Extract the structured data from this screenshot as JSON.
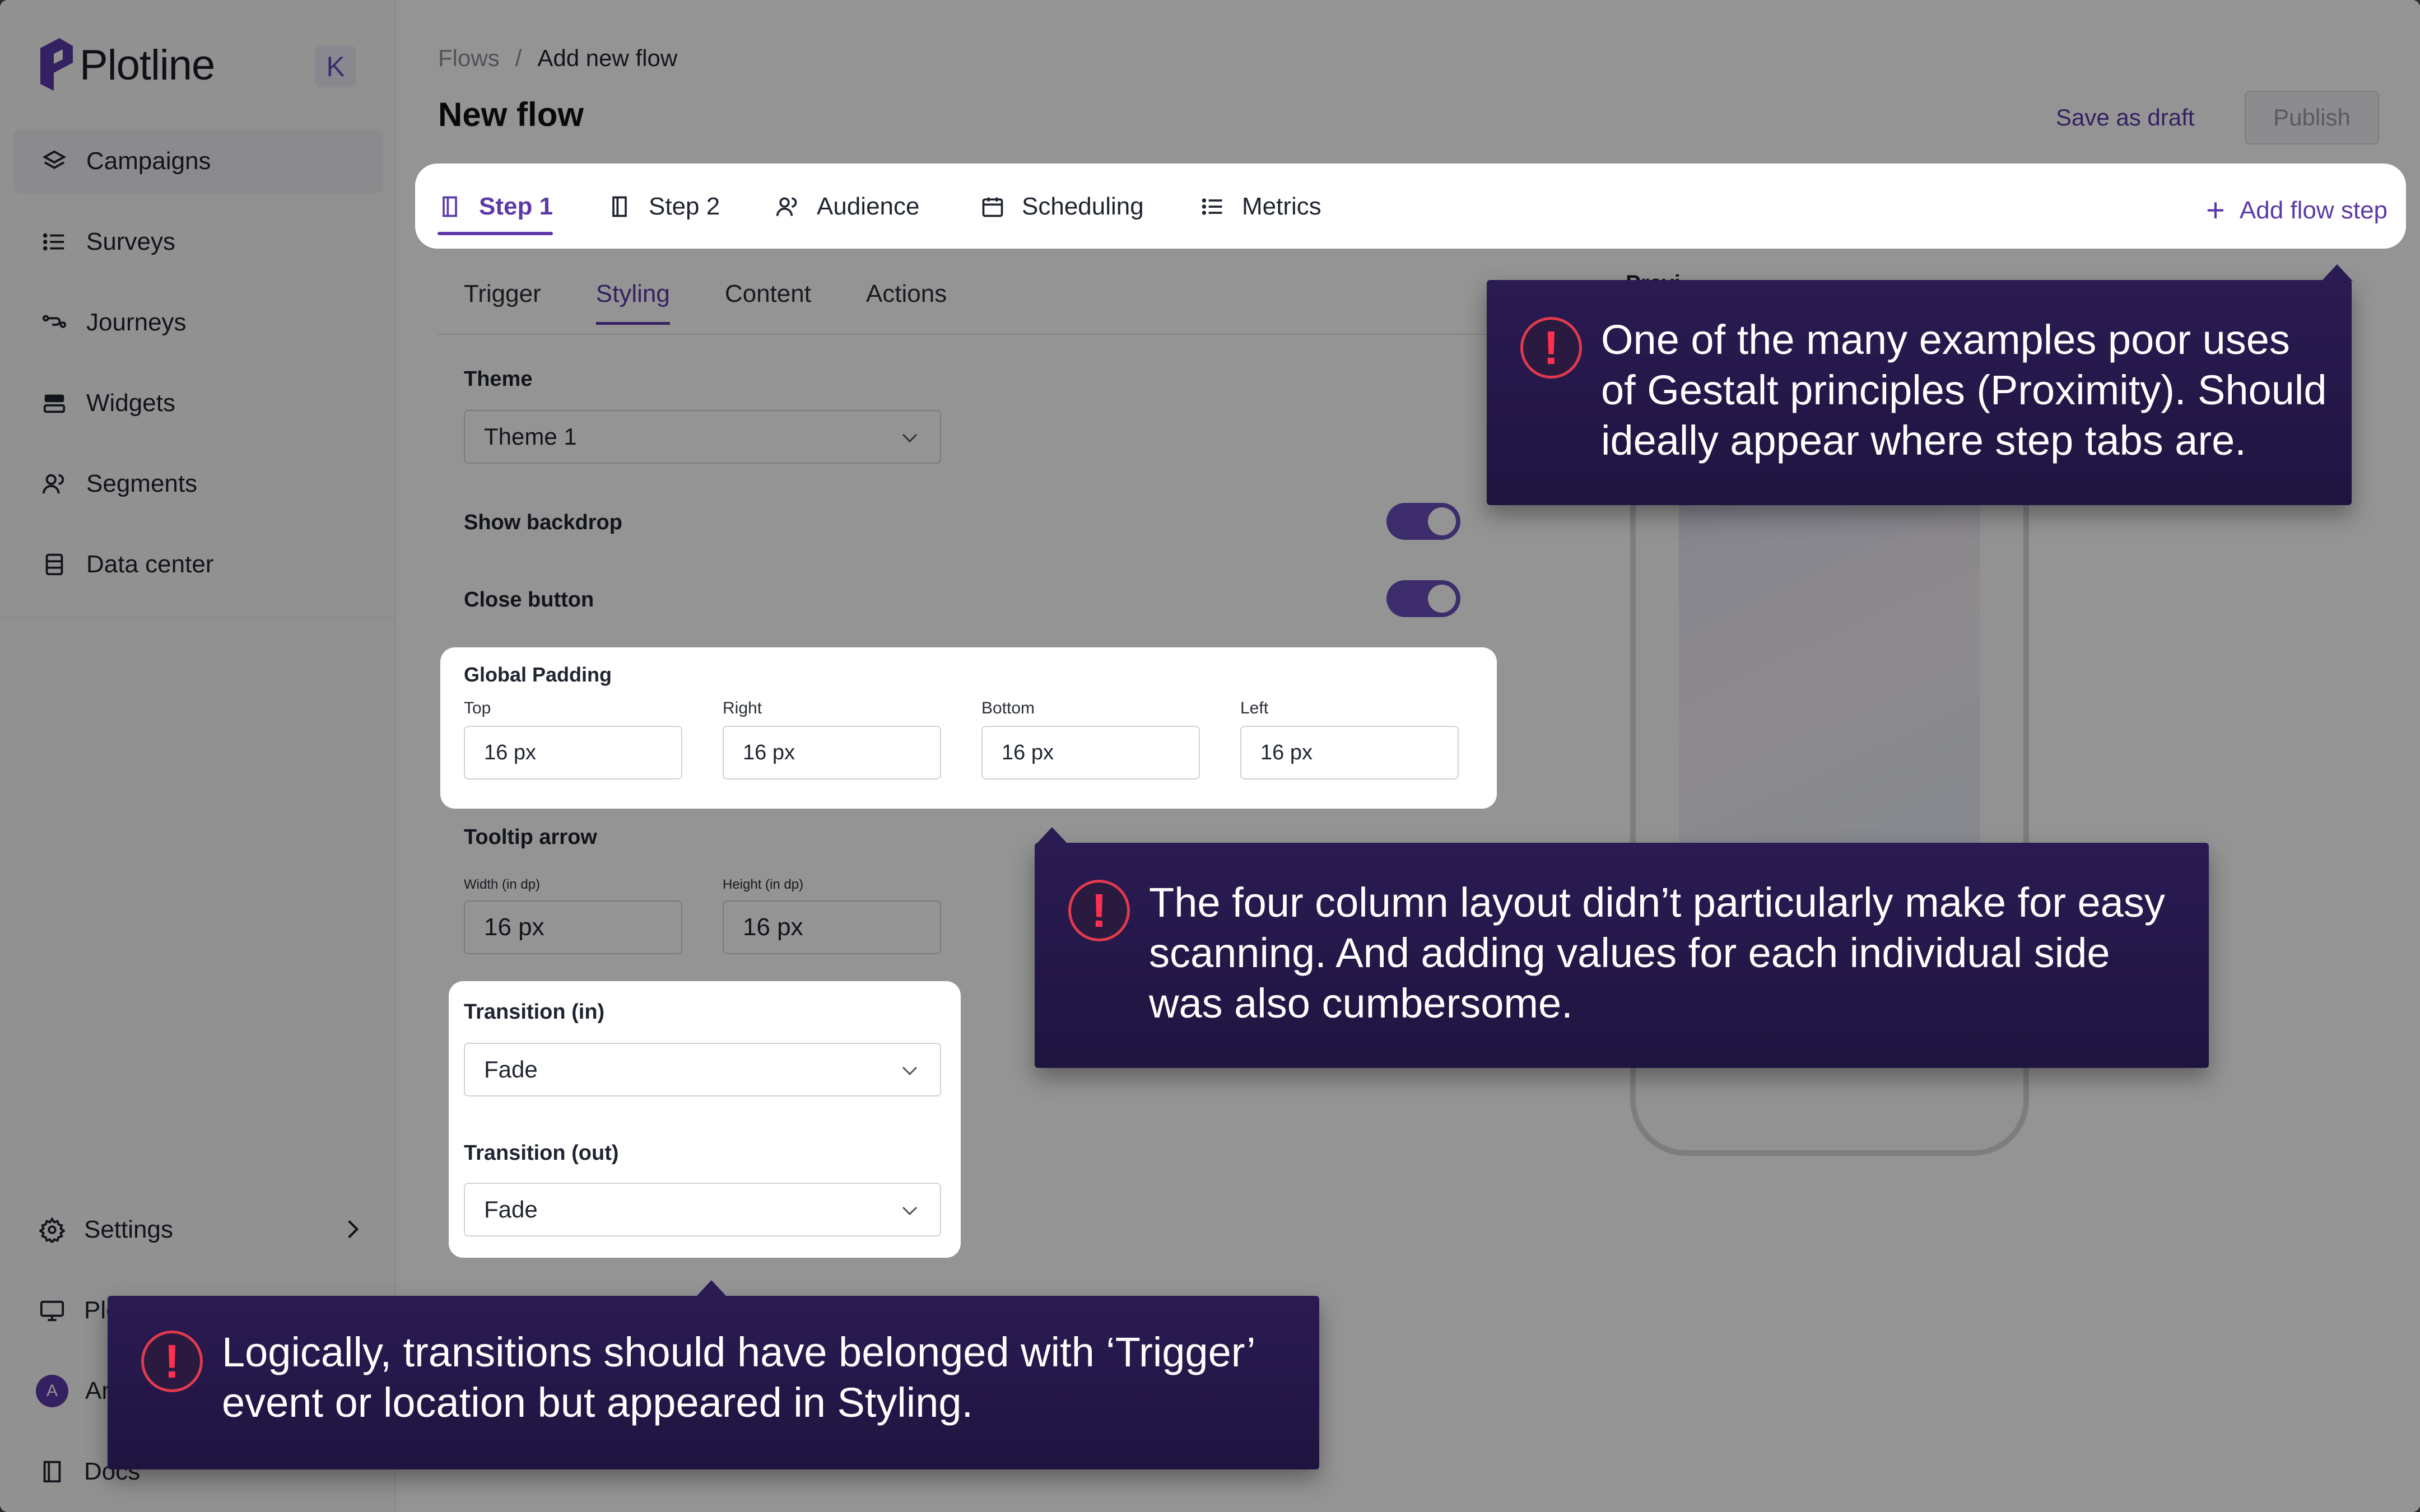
{
  "brand": {
    "name": "Plotline",
    "collapse_label": "K"
  },
  "sidebar": {
    "items": [
      {
        "label": "Campaigns",
        "icon": "layers-icon"
      },
      {
        "label": "Surveys",
        "icon": "list-icon"
      },
      {
        "label": "Journeys",
        "icon": "route-icon"
      },
      {
        "label": "Widgets",
        "icon": "widget-icon"
      },
      {
        "label": "Segments",
        "icon": "users-icon"
      },
      {
        "label": "Data center",
        "icon": "database-icon"
      }
    ],
    "settings_label": "Settings",
    "bottom_items": [
      {
        "label": "Plo",
        "icon": "monitor-icon"
      },
      {
        "label": "Ar",
        "avatar": "A"
      },
      {
        "label": "Docs",
        "icon": "book-icon"
      }
    ]
  },
  "header": {
    "breadcrumb": {
      "parent": "Flows",
      "separator": "/",
      "current": "Add new flow"
    },
    "title": "New flow",
    "save_draft_label": "Save as draft",
    "publish_label": "Publish"
  },
  "steps": {
    "tabs": [
      {
        "label": "Step 1",
        "icon": "page-icon"
      },
      {
        "label": "Step 2",
        "icon": "page-icon"
      },
      {
        "label": "Audience",
        "icon": "users-icon"
      },
      {
        "label": "Scheduling",
        "icon": "calendar-icon"
      },
      {
        "label": "Metrics",
        "icon": "list-icon"
      }
    ],
    "add_label": "Add flow step"
  },
  "sub_tabs": [
    "Trigger",
    "Styling",
    "Content",
    "Actions"
  ],
  "styling": {
    "theme_label": "Theme",
    "theme_value": "Theme 1",
    "show_backdrop_label": "Show backdrop",
    "close_button_label": "Close button",
    "global_padding": {
      "label": "Global Padding",
      "fields": [
        {
          "label": "Top",
          "value": "16 px"
        },
        {
          "label": "Right",
          "value": "16 px"
        },
        {
          "label": "Bottom",
          "value": "16 px"
        },
        {
          "label": "Left",
          "value": "16 px"
        }
      ]
    },
    "tooltip_arrow": {
      "label": "Tooltip arrow",
      "width_label": "Width (in dp)",
      "width_value": "16 px",
      "height_label": "Height (in dp)",
      "height_value": "16 px"
    },
    "transition_in_label": "Transition (in)",
    "transition_in_value": "Fade",
    "transition_out_label": "Transition (out)",
    "transition_out_value": "Fade"
  },
  "preview": {
    "label": "Previ"
  },
  "callouts": [
    {
      "text": "One of the many examples poor uses of Gestalt principles (Proximity). Should ideally appear where step tabs are."
    },
    {
      "text": "The four column layout didn’t particularly make for easy scanning. And adding values for each individual side was also cumbersome."
    },
    {
      "text": "Logically, transitions should have belonged with ‘Trigger’ event or location but appeared in Styling."
    }
  ],
  "colors": {
    "accent": "#5b3aa8",
    "callout_bg": "#24184a",
    "warning": "#ff3050"
  }
}
